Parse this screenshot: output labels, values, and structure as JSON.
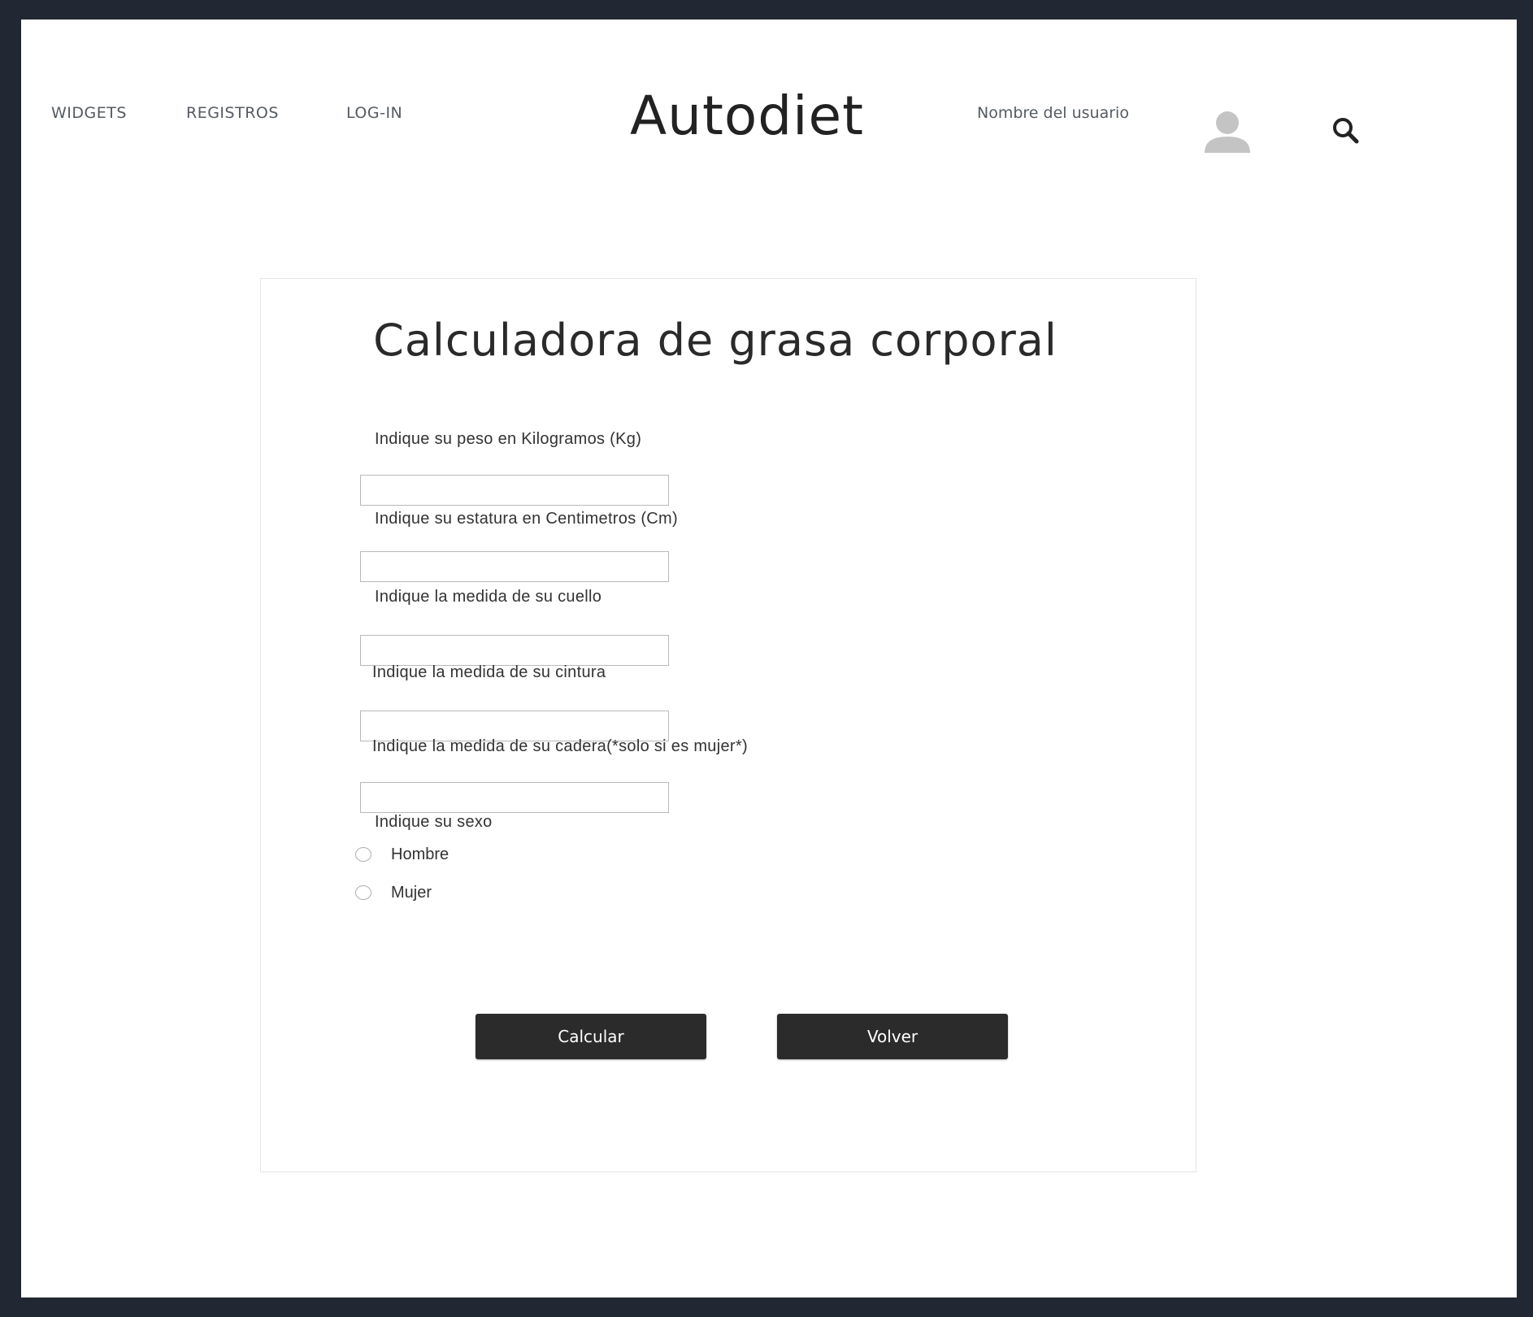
{
  "nav": {
    "widgets": "WIDGETS",
    "registros": "REGISTROS",
    "login": "LOG-IN"
  },
  "brand": {
    "logo": "Autodiet"
  },
  "user": {
    "name": "Nombre del usuario"
  },
  "icons": {
    "avatar": "user-avatar-icon",
    "search": "search-icon"
  },
  "form": {
    "title": "Calculadora de grasa corporal",
    "fields": [
      {
        "label": "Indique su peso en Kilogramos (Kg)",
        "value": "",
        "placeholder": ""
      },
      {
        "label": "Indique su estatura en Centimetros (Cm)",
        "value": "",
        "placeholder": ""
      },
      {
        "label": "Indique la medida de su cuello",
        "value": "",
        "placeholder": ""
      },
      {
        "label": "Indique la medida de su cintura",
        "value": "",
        "placeholder": ""
      },
      {
        "label": "Indique la medida de su cadera(*solo si es mujer*)",
        "value": "",
        "placeholder": ""
      }
    ],
    "sex": {
      "label": "Indique su sexo",
      "options": [
        "Hombre",
        "Mujer"
      ],
      "selected": ""
    },
    "buttons": {
      "calcular": "Calcular",
      "volver": "Volver"
    }
  },
  "colors": {
    "frame": "#222833",
    "button": "#2b2b2b",
    "nav_text": "#555b62"
  }
}
